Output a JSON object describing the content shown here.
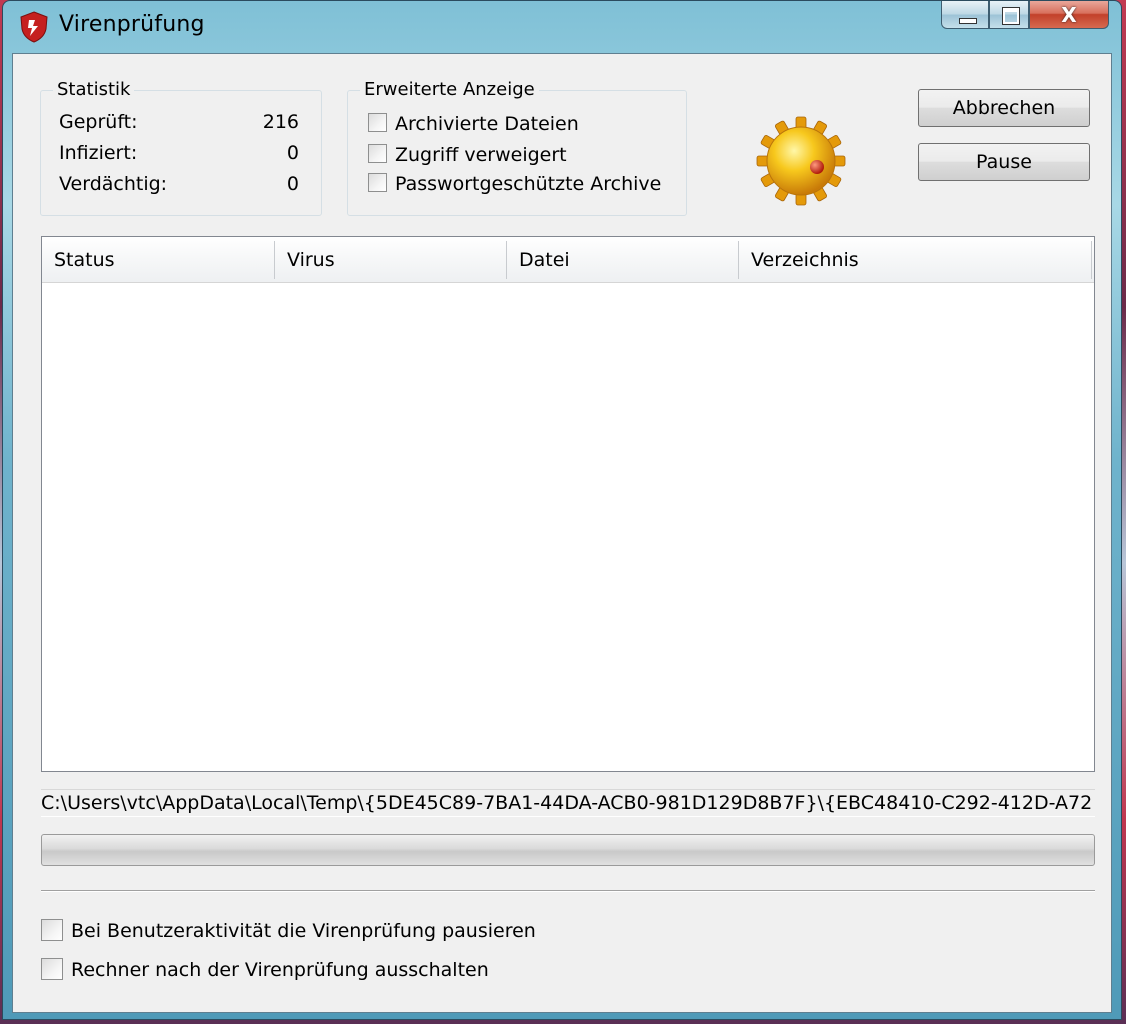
{
  "window": {
    "title": "Virenprüfung",
    "buttons": {
      "minimize": "minimize",
      "maximize": "maximize",
      "close": "X"
    }
  },
  "statistik": {
    "title": "Statistik",
    "rows": [
      {
        "label": "Geprüft:",
        "value": "216"
      },
      {
        "label": "Infiziert:",
        "value": "0"
      },
      {
        "label": "Verdächtig:",
        "value": "0"
      }
    ]
  },
  "erweiterte": {
    "title": "Erweiterte Anzeige",
    "options": [
      {
        "label": "Archivierte Dateien",
        "checked": false
      },
      {
        "label": "Zugriff verweigert",
        "checked": false
      },
      {
        "label": "Passwortgeschützte Archive",
        "checked": false
      }
    ]
  },
  "actions": {
    "cancel": "Abbrechen",
    "pause": "Pause"
  },
  "list": {
    "columns": [
      "Status",
      "Virus",
      "Datei",
      "Verzeichnis"
    ],
    "rows": []
  },
  "current_path": "C:\\Users\\vtc\\AppData\\Local\\Temp\\{5DE45C89-7BA1-44DA-ACB0-981D129D8B7F}\\{EBC48410-C292-412D-A72",
  "progress": {
    "fraction": 0.0
  },
  "bottom_options": [
    {
      "label": "Bei Benutzeraktivität die Virenprüfung pausieren",
      "checked": false
    },
    {
      "label": "Rechner nach der Virenprüfung ausschalten",
      "checked": false
    }
  ],
  "icons": {
    "app": "shield-icon",
    "status": "gear-sun-icon"
  },
  "colors": {
    "accent_gear": "#f3b511",
    "gear_dot": "#d8321e",
    "window_frame": "#7fc0d6"
  }
}
